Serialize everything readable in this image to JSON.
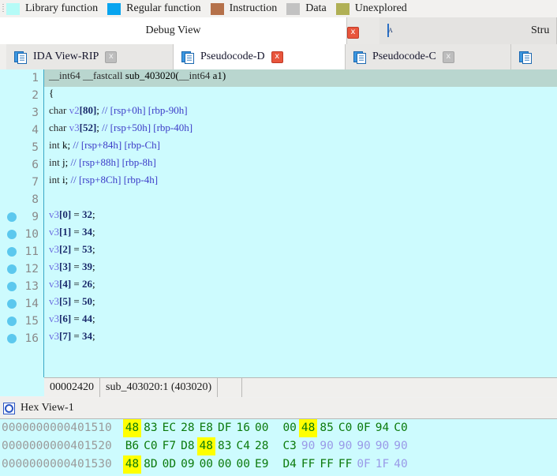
{
  "legend": {
    "items": [
      {
        "label": "Library function",
        "color": "#b5fbf7"
      },
      {
        "label": "Regular function",
        "color": "#07a4ef"
      },
      {
        "label": "Instruction",
        "color": "#b5714a"
      },
      {
        "label": "Data",
        "color": "#c2c2c2"
      },
      {
        "label": "Unexplored",
        "color": "#b0b055"
      }
    ]
  },
  "top_tabs": [
    {
      "label": "Debug View",
      "active": true,
      "close": "x",
      "close_state": "red",
      "icon": ""
    },
    {
      "label": "",
      "active": false,
      "close": "",
      "close_state": "none",
      "icon": "window-a-icon"
    },
    {
      "label": "Stru",
      "active": false,
      "close": "",
      "close_state": "none",
      "icon": ""
    }
  ],
  "bottom_tabs": [
    {
      "label": "IDA View-RIP",
      "active": false,
      "close": "x",
      "close_state": "grey"
    },
    {
      "label": "Pseudocode-D",
      "active": true,
      "close": "x",
      "close_state": "red"
    },
    {
      "label": "Pseudocode-C",
      "active": false,
      "close": "x",
      "close_state": "grey"
    },
    {
      "label": "",
      "active": false,
      "close": "",
      "close_state": "none"
    }
  ],
  "editor": {
    "lines": [
      {
        "num": "1",
        "breakpoint": false,
        "highlight": true,
        "text": "__int64 __fastcall sub_403020(__int64 a1)"
      },
      {
        "num": "2",
        "breakpoint": false,
        "highlight": false,
        "text": "{"
      },
      {
        "num": "3",
        "breakpoint": false,
        "highlight": false,
        "text": "  char v2[80]; // [rsp+0h] [rbp-90h]"
      },
      {
        "num": "4",
        "breakpoint": false,
        "highlight": false,
        "text": "  char v3[52]; // [rsp+50h] [rbp-40h]"
      },
      {
        "num": "5",
        "breakpoint": false,
        "highlight": false,
        "text": "  int k; // [rsp+84h] [rbp-Ch]"
      },
      {
        "num": "6",
        "breakpoint": false,
        "highlight": false,
        "text": "  int j; // [rsp+88h] [rbp-8h]"
      },
      {
        "num": "7",
        "breakpoint": false,
        "highlight": false,
        "text": "  int i; // [rsp+8Ch] [rbp-4h]"
      },
      {
        "num": "8",
        "breakpoint": false,
        "highlight": false,
        "text": ""
      },
      {
        "num": "9",
        "breakpoint": true,
        "highlight": false,
        "text": "  v3[0] = 32;"
      },
      {
        "num": "10",
        "breakpoint": true,
        "highlight": false,
        "text": "  v3[1] = 34;"
      },
      {
        "num": "11",
        "breakpoint": true,
        "highlight": false,
        "text": "  v3[2] = 53;"
      },
      {
        "num": "12",
        "breakpoint": true,
        "highlight": false,
        "text": "  v3[3] = 39;"
      },
      {
        "num": "13",
        "breakpoint": true,
        "highlight": false,
        "text": "  v3[4] = 26;"
      },
      {
        "num": "14",
        "breakpoint": true,
        "highlight": false,
        "text": "  v3[5] = 50;"
      },
      {
        "num": "15",
        "breakpoint": true,
        "highlight": false,
        "text": "  v3[6] = 44;"
      },
      {
        "num": "16",
        "breakpoint": true,
        "highlight": false,
        "text": "  v3[7] = 34;"
      }
    ]
  },
  "status_bar": {
    "offset": "00002420",
    "location": "sub_403020:1  (403020)"
  },
  "hex_view": {
    "title": "Hex View-1",
    "rows": [
      {
        "address": "0000000000401510",
        "bytes": [
          {
            "v": "48",
            "hl": true,
            "nop": false
          },
          {
            "v": "83",
            "hl": false,
            "nop": false
          },
          {
            "v": "EC",
            "hl": false,
            "nop": false
          },
          {
            "v": "28",
            "hl": false,
            "nop": false
          },
          {
            "v": "E8",
            "hl": false,
            "nop": false
          },
          {
            "v": "DF",
            "hl": false,
            "nop": false
          },
          {
            "v": "16",
            "hl": false,
            "nop": false
          },
          {
            "v": "00",
            "hl": false,
            "nop": false
          },
          {
            "v": "00",
            "hl": false,
            "nop": false
          },
          {
            "v": "48",
            "hl": true,
            "nop": false
          },
          {
            "v": "85",
            "hl": false,
            "nop": false
          },
          {
            "v": "C0",
            "hl": false,
            "nop": false
          },
          {
            "v": "0F",
            "hl": false,
            "nop": false
          },
          {
            "v": "94",
            "hl": false,
            "nop": false
          },
          {
            "v": "C0",
            "hl": false,
            "nop": false
          }
        ]
      },
      {
        "address": "0000000000401520",
        "bytes": [
          {
            "v": "B6",
            "hl": false,
            "nop": false
          },
          {
            "v": "C0",
            "hl": false,
            "nop": false
          },
          {
            "v": "F7",
            "hl": false,
            "nop": false
          },
          {
            "v": "D8",
            "hl": false,
            "nop": false
          },
          {
            "v": "48",
            "hl": true,
            "nop": false
          },
          {
            "v": "83",
            "hl": false,
            "nop": false
          },
          {
            "v": "C4",
            "hl": false,
            "nop": false
          },
          {
            "v": "28",
            "hl": false,
            "nop": false
          },
          {
            "v": "C3",
            "hl": false,
            "nop": false
          },
          {
            "v": "90",
            "hl": false,
            "nop": true
          },
          {
            "v": "90",
            "hl": false,
            "nop": true
          },
          {
            "v": "90",
            "hl": false,
            "nop": true
          },
          {
            "v": "90",
            "hl": false,
            "nop": true
          },
          {
            "v": "90",
            "hl": false,
            "nop": true
          },
          {
            "v": "90",
            "hl": false,
            "nop": true
          }
        ]
      },
      {
        "address": "0000000000401530",
        "bytes": [
          {
            "v": "48",
            "hl": true,
            "nop": false
          },
          {
            "v": "8D",
            "hl": false,
            "nop": false
          },
          {
            "v": "0D",
            "hl": false,
            "nop": false
          },
          {
            "v": "09",
            "hl": false,
            "nop": false
          },
          {
            "v": "00",
            "hl": false,
            "nop": false
          },
          {
            "v": "00",
            "hl": false,
            "nop": false
          },
          {
            "v": "00",
            "hl": false,
            "nop": false
          },
          {
            "v": "E9",
            "hl": false,
            "nop": false
          },
          {
            "v": "D4",
            "hl": false,
            "nop": false
          },
          {
            "v": "FF",
            "hl": false,
            "nop": false
          },
          {
            "v": "FF",
            "hl": false,
            "nop": false
          },
          {
            "v": "FF",
            "hl": false,
            "nop": false
          },
          {
            "v": "0F",
            "hl": false,
            "nop": true
          },
          {
            "v": "1F",
            "hl": false,
            "nop": true
          },
          {
            "v": "40",
            "hl": false,
            "nop": true
          }
        ]
      }
    ]
  }
}
